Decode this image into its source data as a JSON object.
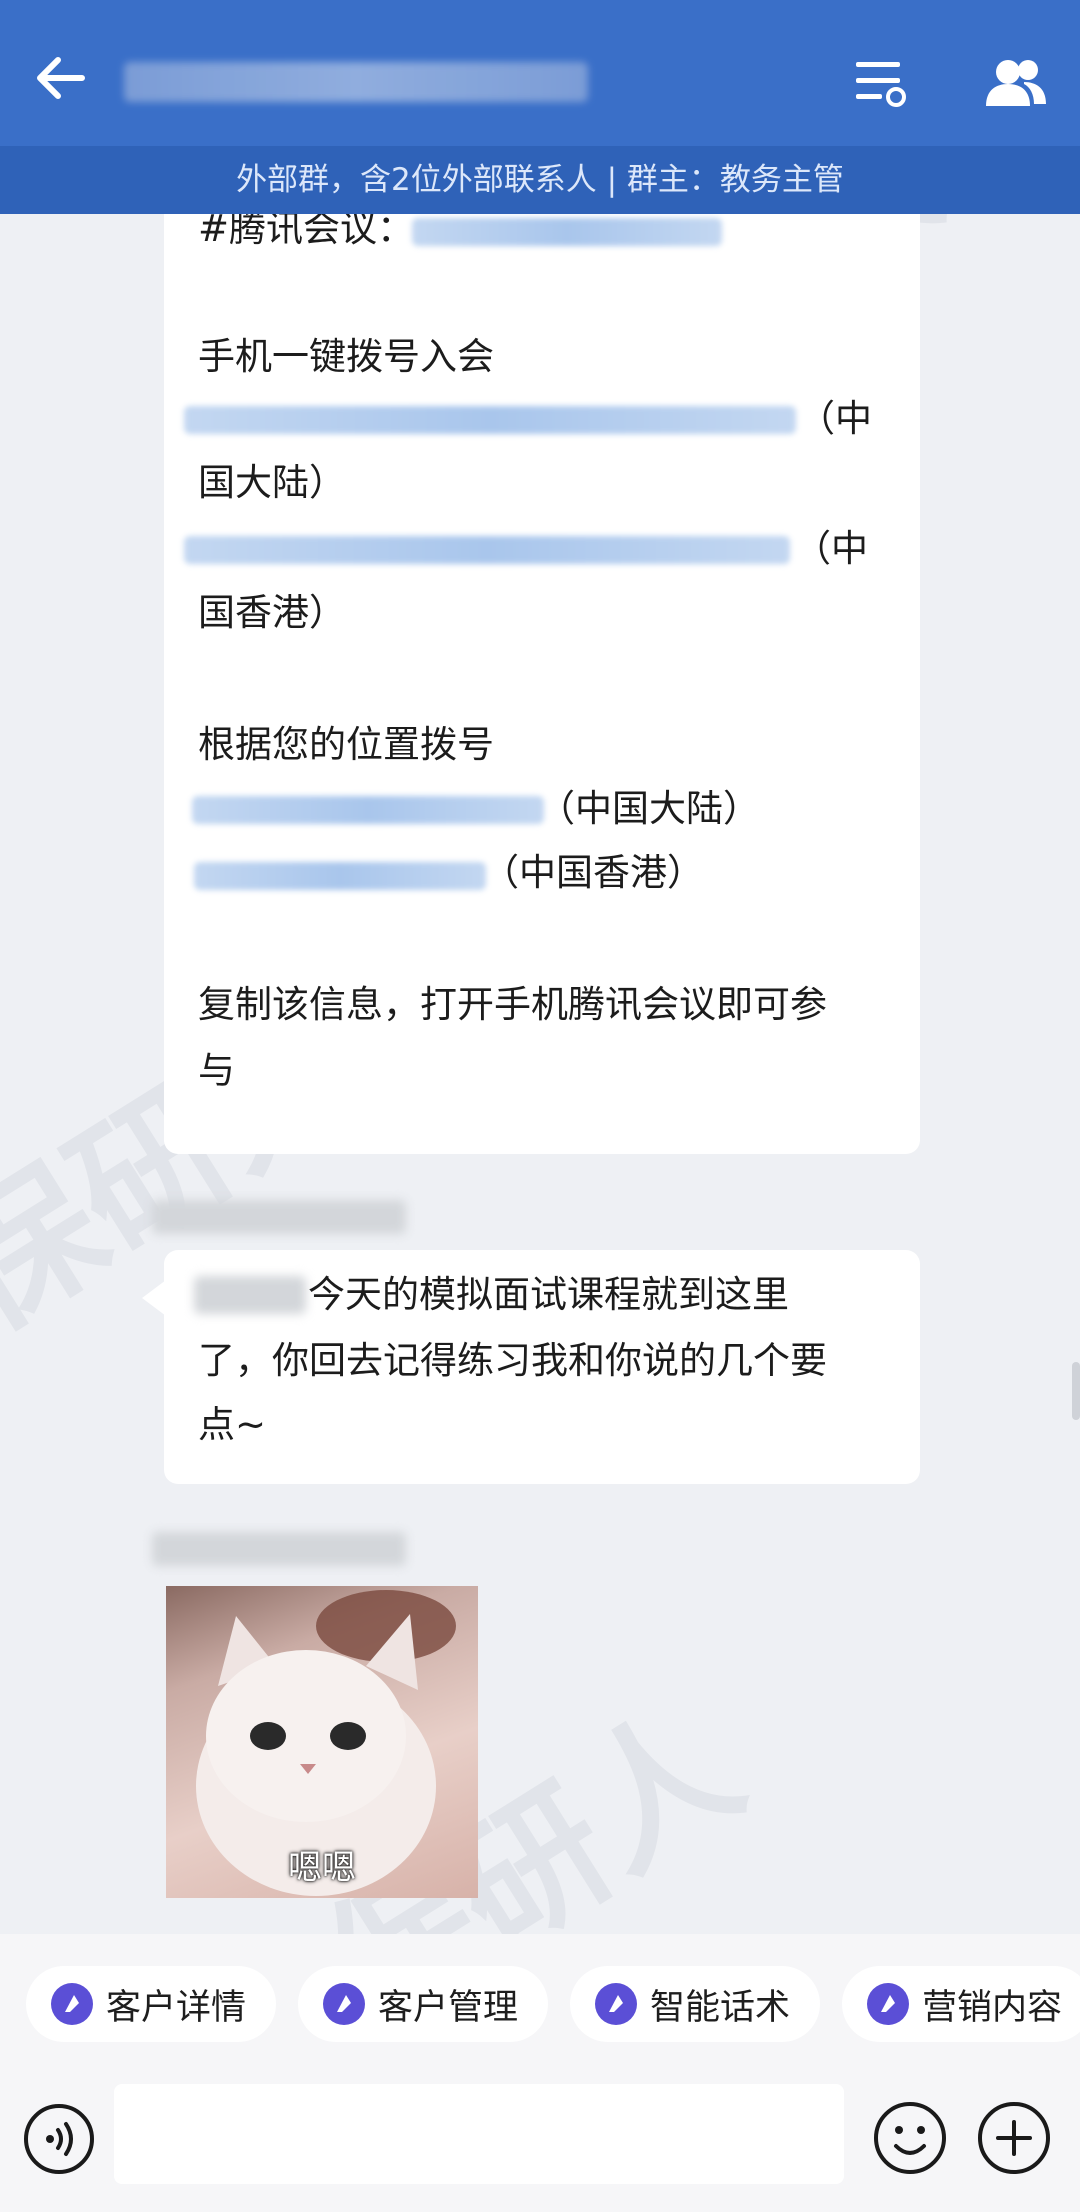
{
  "header": {
    "subtitle": "外部群，含2位外部联系人 | 群主：教务主管"
  },
  "messages": {
    "meeting": {
      "line1": "#腾讯会议：",
      "line2": "手机一键拨号入会",
      "suffix1a": "（中",
      "suffix1b": "国大陆）",
      "suffix2a": "（中",
      "suffix2b": "国香港）",
      "line3": "根据您的位置拨号",
      "loc1": "（中国大陆）",
      "loc2": "（中国香港）",
      "line4a": "复制该信息，打开手机腾讯会议即可参",
      "line4b": "与"
    },
    "text": {
      "line1": "今天的模拟面试课程就到这里",
      "line2": "了，你回去记得练习我和你说的几个要",
      "line3": "点~"
    },
    "sticker": {
      "caption": "嗯嗯"
    }
  },
  "tools": [
    {
      "label": "客户详情",
      "icon": "toolkit-icon"
    },
    {
      "label": "客户管理",
      "icon": "toolkit-icon"
    },
    {
      "label": "智能话术",
      "icon": "toolkit-icon"
    },
    {
      "label": "营销内容",
      "icon": "toolkit-icon"
    }
  ],
  "watermark": "保研人",
  "colors": {
    "header": "#3a6fc8",
    "subheader": "#2f62b8",
    "background": "#eef0f4",
    "chip_icon": "#5b4fd6"
  }
}
